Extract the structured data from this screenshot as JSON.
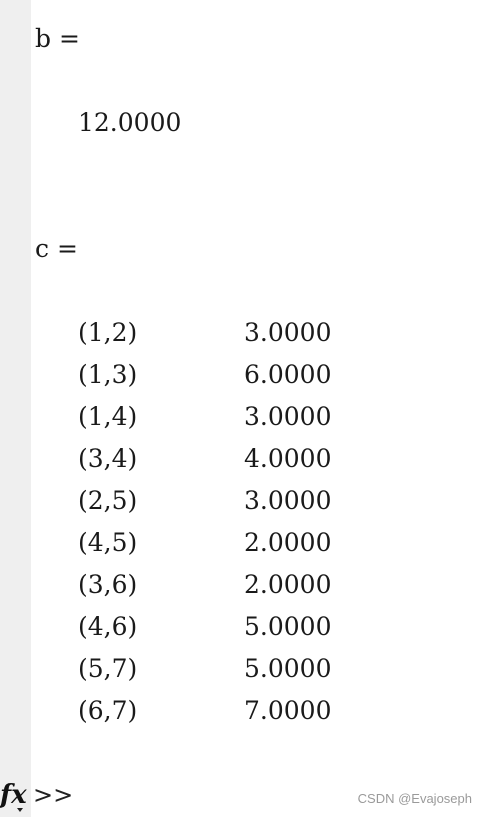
{
  "output": {
    "b": {
      "label": "b =",
      "value": "12.0000"
    },
    "c": {
      "label": "c =",
      "rows": [
        {
          "index": "(1,2)",
          "value": "3.0000"
        },
        {
          "index": "(1,3)",
          "value": "6.0000"
        },
        {
          "index": "(1,4)",
          "value": "3.0000"
        },
        {
          "index": "(3,4)",
          "value": "4.0000"
        },
        {
          "index": "(2,5)",
          "value": "3.0000"
        },
        {
          "index": "(4,5)",
          "value": "2.0000"
        },
        {
          "index": "(3,6)",
          "value": "2.0000"
        },
        {
          "index": "(4,6)",
          "value": "5.0000"
        },
        {
          "index": "(5,7)",
          "value": "5.0000"
        },
        {
          "index": "(6,7)",
          "value": "7.0000"
        }
      ]
    }
  },
  "prompt": {
    "icon": "fx-icon",
    "symbol": ">>"
  },
  "watermark": "CSDN @Evajoseph"
}
